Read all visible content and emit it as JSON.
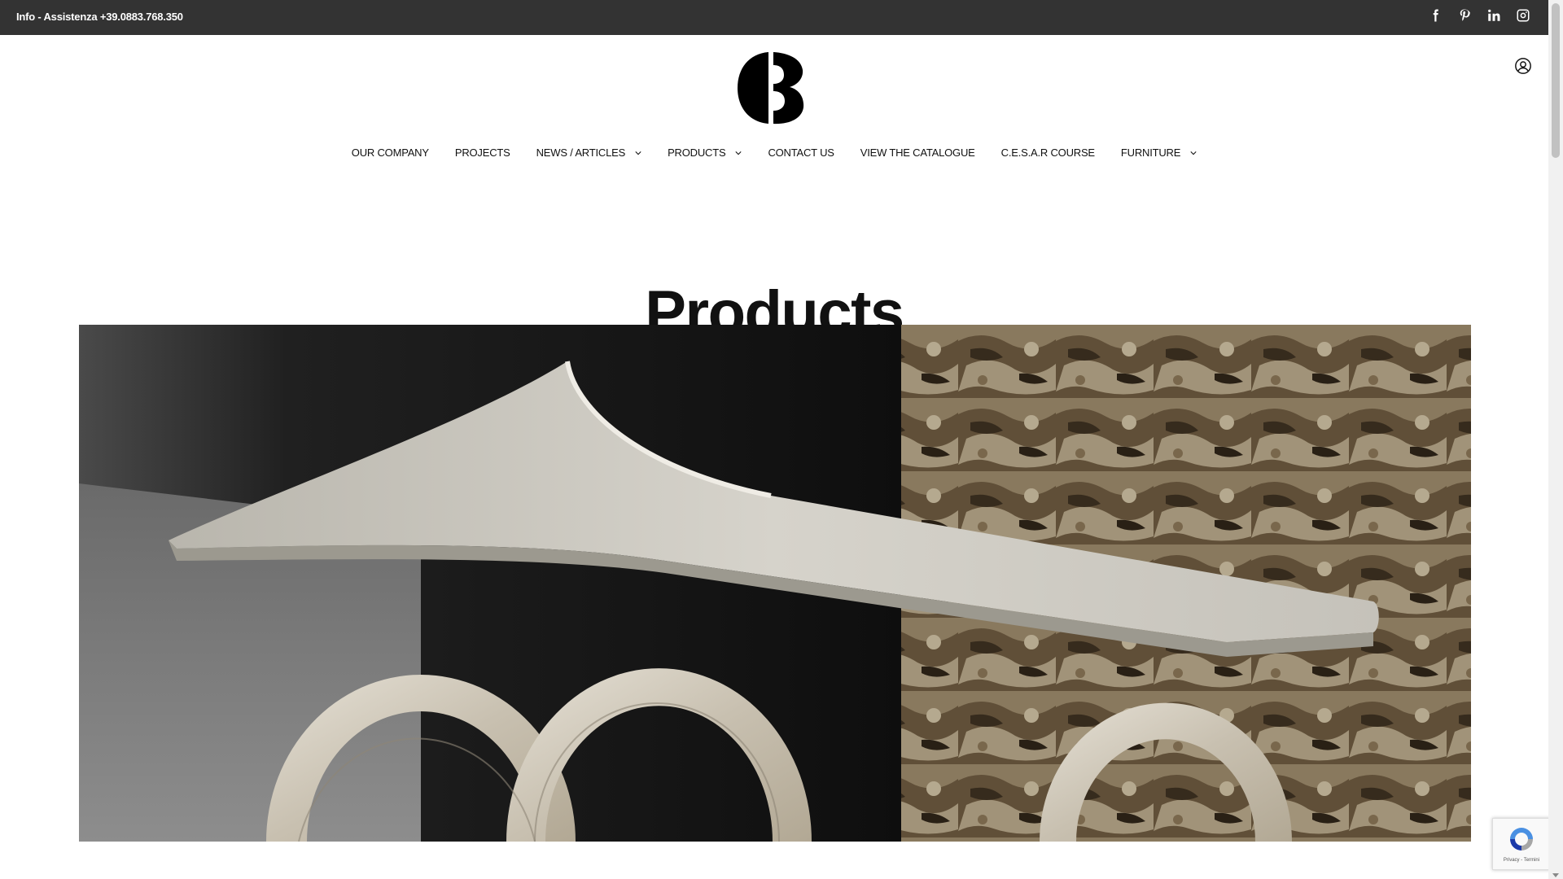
{
  "topbar": {
    "info": "Info - Assistenza +39.0883.768.350",
    "social": [
      {
        "icon": "facebook-icon"
      },
      {
        "icon": "pinterest-icon"
      },
      {
        "icon": "linkedin-icon"
      },
      {
        "icon": "instagram-icon"
      }
    ]
  },
  "header": {
    "logo": "brand-logo",
    "user_icon": "user-account-icon"
  },
  "nav": {
    "items": [
      {
        "label": "OUR COMPANY"
      },
      {
        "label": "PROJECTS"
      },
      {
        "label": "NEWS / ARTICLES",
        "dropdown": true
      },
      {
        "label": "PRODUCTS",
        "dropdown": true
      },
      {
        "label": "CONTACT US"
      },
      {
        "label": "VIEW THE CATALOGUE"
      },
      {
        "label": "C.E.S.A.R COURSE"
      },
      {
        "label": "FURNITURE",
        "dropdown": true
      }
    ]
  },
  "page": {
    "title": "Products"
  },
  "recaptcha": {
    "text": "Privacy - Termini"
  },
  "colors": {
    "topbar": "#333333",
    "text": "#111111",
    "background": "#ffffff"
  }
}
